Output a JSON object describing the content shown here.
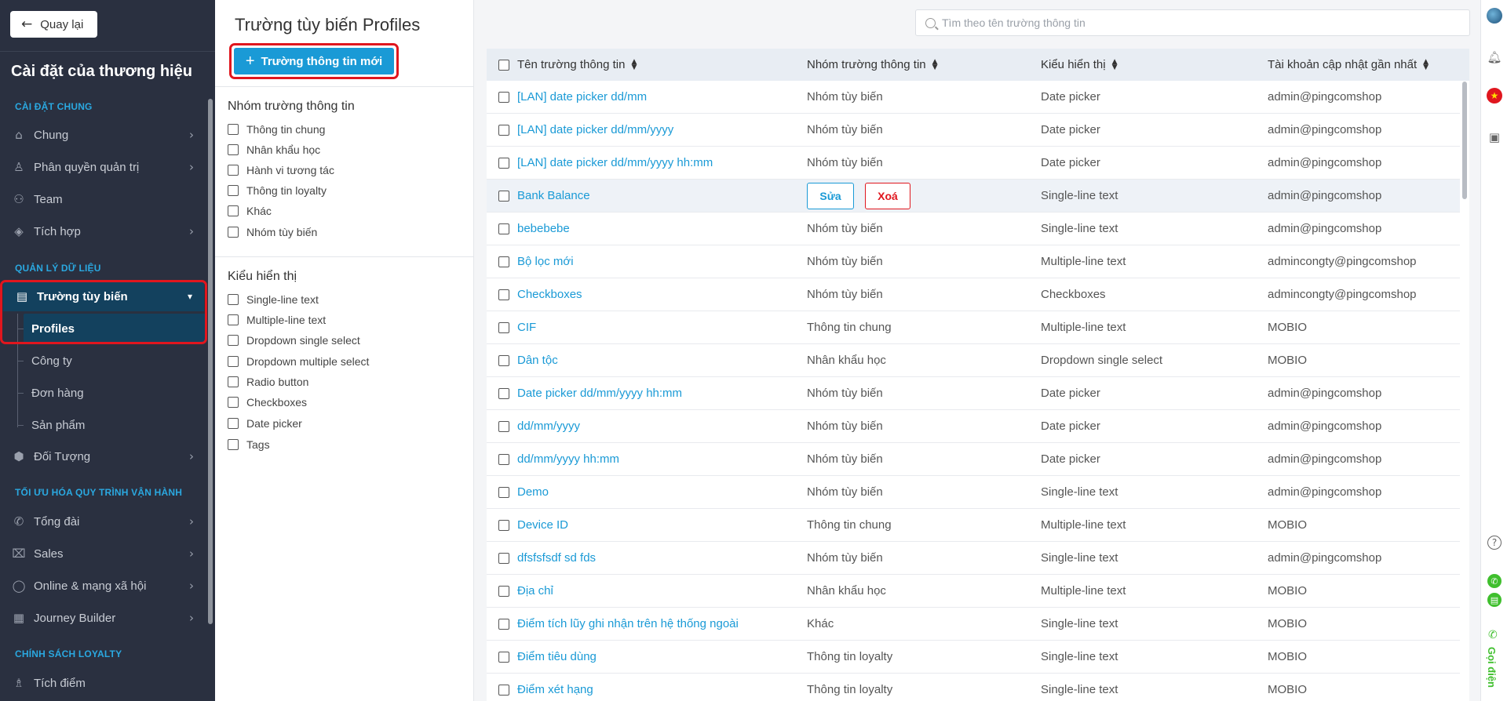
{
  "sidebar": {
    "back_label": "Quay lại",
    "brand_title": "Cài đặt của thương hiệu",
    "sections": [
      "CÀI ĐẶT CHUNG",
      "QUẢN LÝ DỮ LIỆU",
      "TỐI ƯU HÓA QUY TRÌNH VẬN HÀNH",
      "CHÍNH SÁCH LOYALTY"
    ],
    "items": {
      "chung": "Chung",
      "phan_quyen": "Phân quyền quản trị",
      "team": "Team",
      "tich_hop": "Tích hợp",
      "truong_tuy_bien": "Trường tùy biến",
      "doi_tuong": "Đối Tượng",
      "tong_dai": "Tổng đài",
      "sales": "Sales",
      "online": "Online & mạng xã hội",
      "journey": "Journey Builder",
      "tich_diem": "Tích điểm"
    },
    "sub_items": [
      "Profiles",
      "Công ty",
      "Đơn hàng",
      "Sản phẩm"
    ]
  },
  "filter_panel": {
    "title": "Trường tùy biến Profiles",
    "new_button": "Trường thông tin mới",
    "group_heading": "Nhóm trường thông tin",
    "groups": [
      "Thông tin chung",
      "Nhân khẩu học",
      "Hành vi tương tác",
      "Thông tin loyalty",
      "Khác",
      "Nhóm tùy biến"
    ],
    "type_heading": "Kiểu hiển thị",
    "types": [
      "Single-line text",
      "Multiple-line text",
      "Dropdown single select",
      "Dropdown multiple select",
      "Radio button",
      "Checkboxes",
      "Date picker",
      "Tags"
    ]
  },
  "search": {
    "placeholder": "Tìm theo tên trường thông tin"
  },
  "table": {
    "headers": [
      "Tên trường thông tin",
      "Nhóm trường thông tin",
      "Kiểu hiển thị",
      "Tài khoản cập nhật gần nhất"
    ],
    "edit_label": "Sửa",
    "delete_label": "Xoá",
    "rows": [
      {
        "name": "[LAN] date picker dd/mm",
        "group": "Nhóm tùy biến",
        "type": "Date picker",
        "account": "admin@pingcomshop"
      },
      {
        "name": "[LAN] date picker dd/mm/yyyy",
        "group": "Nhóm tùy biến",
        "type": "Date picker",
        "account": "admin@pingcomshop"
      },
      {
        "name": "[LAN] date picker dd/mm/yyyy hh:mm",
        "group": "Nhóm tùy biến",
        "type": "Date picker",
        "account": "admin@pingcomshop"
      },
      {
        "name": "Bank Balance",
        "group": "",
        "type": "Single-line text",
        "account": "admin@pingcomshop"
      },
      {
        "name": "bebebebe",
        "group": "Nhóm tùy biến",
        "type": "Single-line text",
        "account": "admin@pingcomshop"
      },
      {
        "name": "Bộ lọc mới",
        "group": "Nhóm tùy biến",
        "type": "Multiple-line text",
        "account": "admincongty@pingcomshop"
      },
      {
        "name": "Checkboxes",
        "group": "Nhóm tùy biến",
        "type": "Checkboxes",
        "account": "admincongty@pingcomshop"
      },
      {
        "name": "CIF",
        "group": "Thông tin chung",
        "type": "Multiple-line text",
        "account": "MOBIO"
      },
      {
        "name": "Dân tộc",
        "group": "Nhân khẩu học",
        "type": "Dropdown single select",
        "account": "MOBIO"
      },
      {
        "name": "Date picker dd/mm/yyyy hh:mm",
        "group": "Nhóm tùy biến",
        "type": "Date picker",
        "account": "admin@pingcomshop"
      },
      {
        "name": "dd/mm/yyyy",
        "group": "Nhóm tùy biến",
        "type": "Date picker",
        "account": "admin@pingcomshop"
      },
      {
        "name": "dd/mm/yyyy hh:mm",
        "group": "Nhóm tùy biến",
        "type": "Date picker",
        "account": "admin@pingcomshop"
      },
      {
        "name": "Demo",
        "group": "Nhóm tùy biến",
        "type": "Single-line text",
        "account": "admin@pingcomshop"
      },
      {
        "name": "Device ID",
        "group": "Thông tin chung",
        "type": "Multiple-line text",
        "account": "MOBIO"
      },
      {
        "name": "dfsfsfsdf sd fds",
        "group": "Nhóm tùy biến",
        "type": "Single-line text",
        "account": "admin@pingcomshop"
      },
      {
        "name": "Địa chỉ",
        "group": "Nhân khẩu học",
        "type": "Multiple-line text",
        "account": "MOBIO"
      },
      {
        "name": "Điểm tích lũy ghi nhận trên hệ thống ngoài",
        "group": "Khác",
        "type": "Single-line text",
        "account": "MOBIO"
      },
      {
        "name": "Điểm tiêu dùng",
        "group": "Thông tin loyalty",
        "type": "Single-line text",
        "account": "MOBIO"
      },
      {
        "name": "Điểm xét hạng",
        "group": "Thông tin loyalty",
        "type": "Single-line text",
        "account": "MOBIO"
      }
    ]
  },
  "right_rail": {
    "call_label": "Gọi điện"
  },
  "colors": {
    "sidebar_bg": "#2a3040",
    "accent": "#1a9ad6",
    "active_bg": "#13415e",
    "highlight_red": "#e0161e",
    "call_green": "#3fbf2d"
  }
}
